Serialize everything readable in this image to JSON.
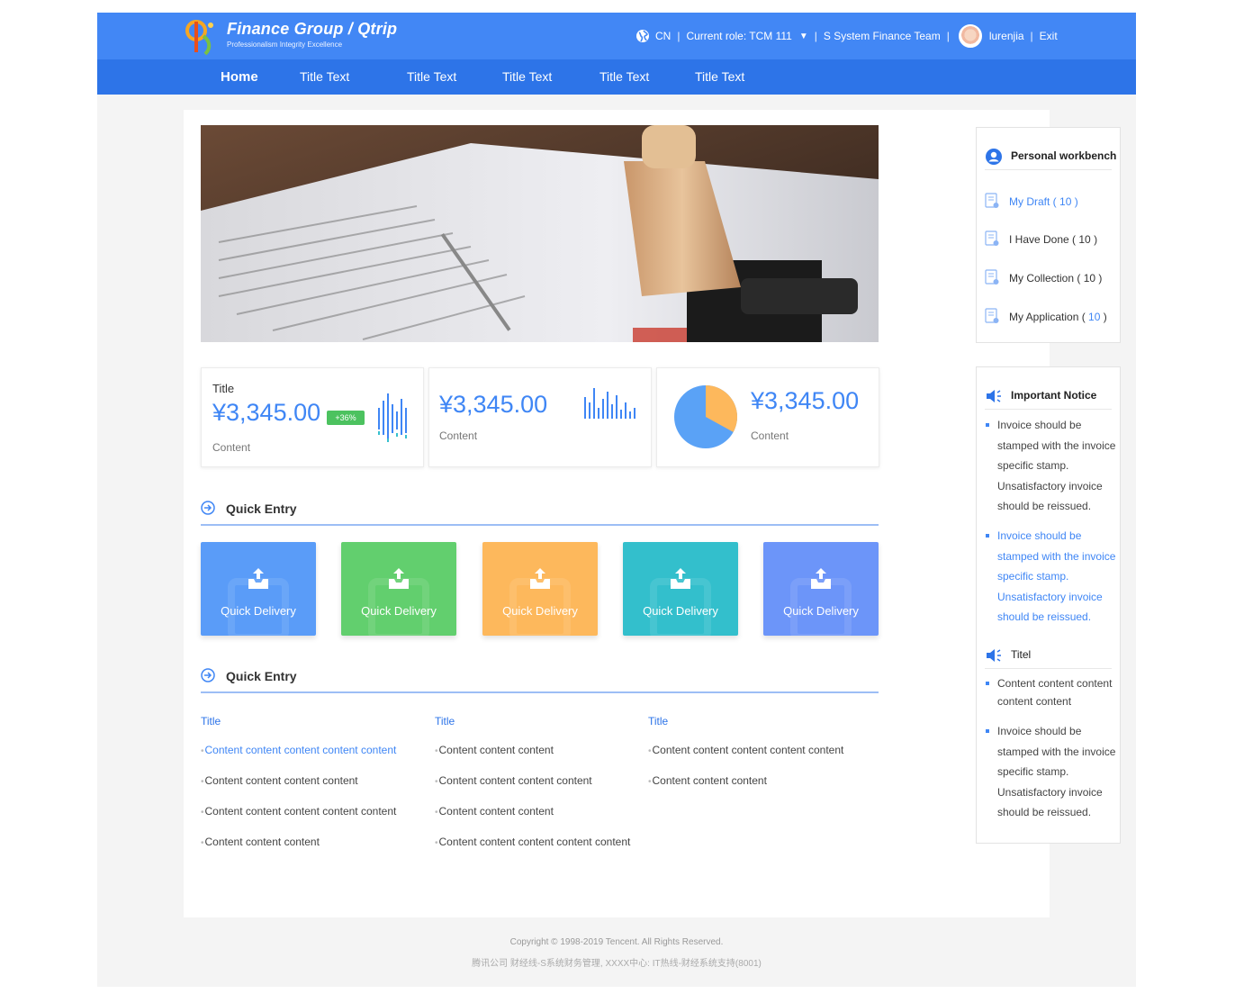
{
  "header": {
    "brand_title": "Finance Group / Qtrip",
    "brand_subtitle": "Professionalism Integrity Excellence",
    "language": "CN",
    "role": "Current role: TCM 111",
    "team": "S System Finance Team",
    "username": "lurenjia",
    "exit_label": "Exit"
  },
  "nav": {
    "items": [
      "Home",
      "Title Text",
      "Title Text",
      "Title Text",
      "Title Text",
      "Title Text"
    ],
    "active": "Home"
  },
  "stats": [
    {
      "title": "Title",
      "value": "¥3,345.00",
      "badge": "+36%",
      "sub": "Content"
    },
    {
      "value": "¥3,345.00",
      "sub": "Content"
    },
    {
      "value": "¥3,345.00",
      "sub": "Content",
      "pie_fraction": 0.33
    }
  ],
  "quick_entry": {
    "title": "Quick Entry",
    "tiles": [
      {
        "label": "Quick Delivery",
        "color": "#5a9cf8"
      },
      {
        "label": "Quick Delivery",
        "color": "#62cf6e"
      },
      {
        "label": "Quick Delivery",
        "color": "#fdb85c"
      },
      {
        "label": "Quick Delivery",
        "color": "#33bfcc"
      },
      {
        "label": "Quick Delivery",
        "color": "#6c95f9"
      }
    ]
  },
  "quick_links": {
    "title": "Quick Entry",
    "columns": [
      {
        "title": "Title",
        "links": [
          "Content content content content content",
          "Content content content content",
          "Content content content content content",
          "Content content content"
        ]
      },
      {
        "title": "Title",
        "links": [
          "Content content content",
          "Content content content content",
          "Content content content",
          "Content content content content content"
        ]
      },
      {
        "title": "Title",
        "links": [
          "Content content content content content",
          "Content content content"
        ]
      }
    ]
  },
  "workbench": {
    "title": "Personal workbench",
    "items": [
      {
        "label": "My Draft",
        "count": "10"
      },
      {
        "label": "I Have Done",
        "count": "10"
      },
      {
        "label": "My Collection",
        "count": "10"
      },
      {
        "label": "My Application",
        "count": "10"
      }
    ]
  },
  "notice": {
    "title": "Important Notice",
    "items": [
      "Invoice should be stamped with the invoice specific stamp. Unsatisfactory invoice should be reissued.",
      "Invoice should be stamped with the invoice specific stamp. Unsatisfactory invoice should be reissued."
    ],
    "title2": "Titel",
    "items2": [
      "Content content content content content",
      "Invoice should be stamped with the invoice specific stamp. Unsatisfactory invoice should be reissued."
    ]
  },
  "footer": {
    "copyright": "Copyright © 1998-2019 Tencent. All Rights Reserved.",
    "info": "腾讯公司 财经线-S系统财务管理, XXXX中心: IT热线-财经系统支持(8001)"
  },
  "colors": {
    "header": "#4287f5",
    "nav": "#2d74e8",
    "accent": "#3f86f5",
    "badge": "#4cc25f"
  }
}
